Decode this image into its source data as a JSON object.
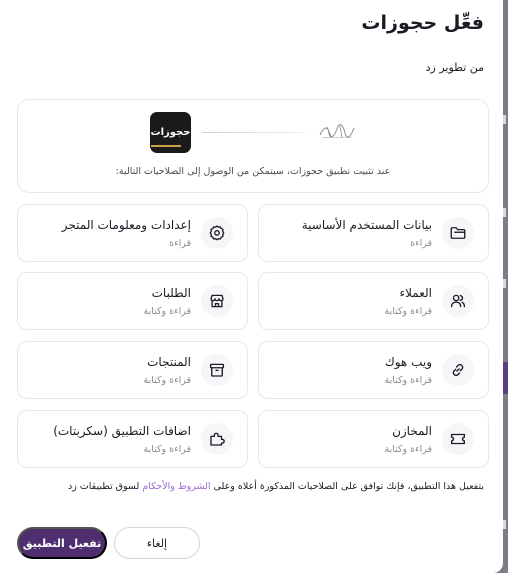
{
  "dialog": {
    "title": "فعِّل حجوزات",
    "developer": "من تطوير زد"
  },
  "install": {
    "app_logo_text": "حجوزات",
    "description": "عند تثبيت تطبيق حجوزات، سيتمكن من الوصول إلى الصلاحيات التالية:"
  },
  "permissions": [
    {
      "title": "بيانات المستخدم الأساسية",
      "access": "قراءة",
      "icon": "folder-icon"
    },
    {
      "title": "إعدادات ومعلومات المتجر",
      "access": "قراءة",
      "icon": "gear-icon"
    },
    {
      "title": "العملاء",
      "access": "قراءة وكتابة",
      "icon": "users-icon"
    },
    {
      "title": "الطلبات",
      "access": "قراءة وكتابة",
      "icon": "store-icon"
    },
    {
      "title": "ويب هوك",
      "access": "قراءة وكتابة",
      "icon": "webhook-icon"
    },
    {
      "title": "المنتجات",
      "access": "قراءة وكتابة",
      "icon": "archive-box-icon"
    },
    {
      "title": "المخازن",
      "access": "قراءة وكتابة",
      "icon": "ticket-icon"
    },
    {
      "title": "اضافات التطبيق (سكربتات)",
      "access": "قراءة وكتابة",
      "icon": "puzzle-icon"
    }
  ],
  "terms": {
    "before": "بتفعيل هذا التطبيق، فإنك توافق على الصلاحيات المذكورة أعلاه وعلى ",
    "link": "الشروط والأحكام",
    "after": " لسوق تطبيقات زد"
  },
  "buttons": {
    "activate": "تفعيل التطبيق",
    "cancel": "إلغاء"
  },
  "colors": {
    "primary": "#4e2e6e",
    "link": "#9b6dd6",
    "border": "#e7e7ee"
  }
}
